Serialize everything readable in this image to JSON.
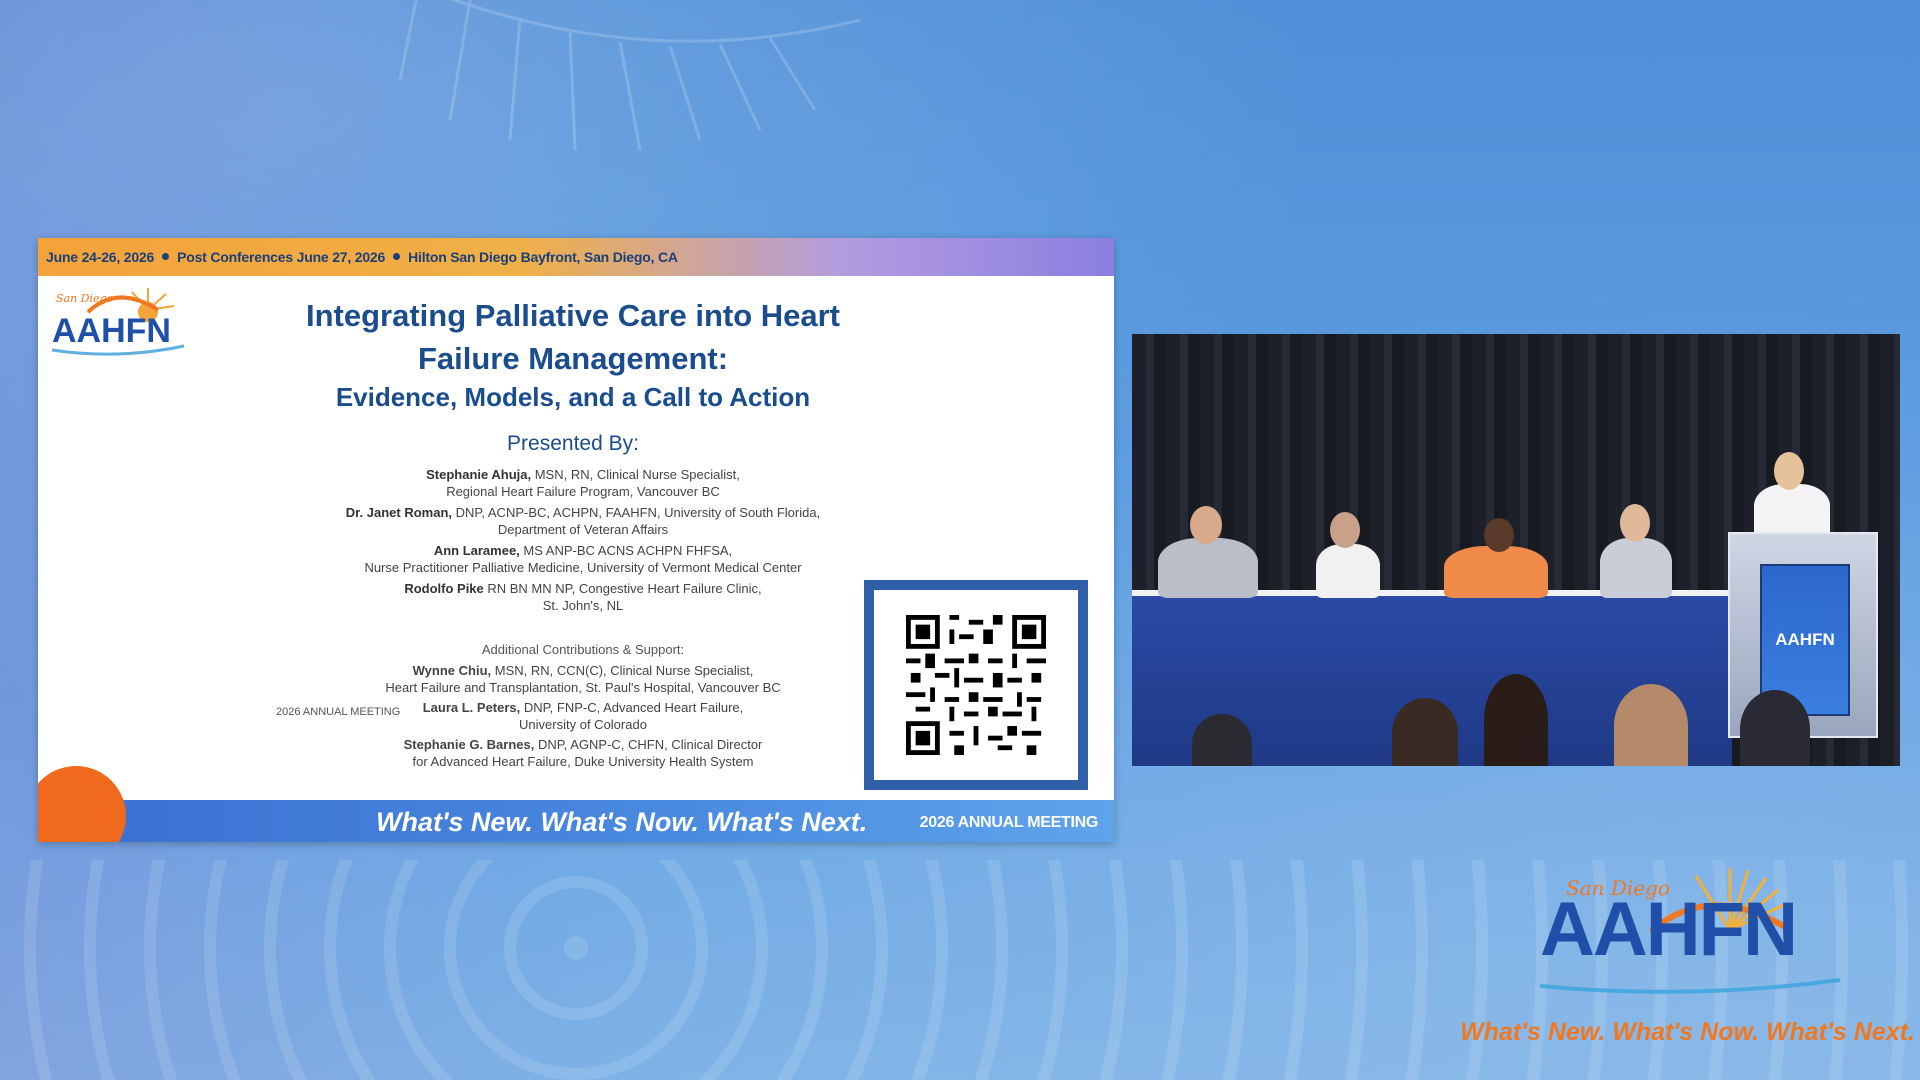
{
  "slide": {
    "event_date": "June 24-26, 2026",
    "post_conferences": "Post Conferences June 27, 2026",
    "venue": "Hilton San Diego Bayfront, San Diego, CA",
    "logo_script": "San Diego",
    "logo_text": "AAHFN",
    "title_line1": "Integrating Palliative Care into Heart",
    "title_line2": "Failure Management:",
    "subtitle": "Evidence, Models, and a Call to Action",
    "presented_by": "Presented By:",
    "presenters": [
      {
        "name": "Stephanie Ahuja,",
        "line1": " MSN, RN, Clinical Nurse Specialist,",
        "line2": "Regional Heart Failure Program, Vancouver BC"
      },
      {
        "name": "Dr. Janet Roman,",
        "line1": " DNP, ACNP-BC, ACHPN, FAAHFN, University of South Florida,",
        "line2": "Department of Veteran Affairs"
      },
      {
        "name": "Ann Laramee,",
        "line1": " MS ANP-BC ACNS ACHPN FHFSA,",
        "line2": "Nurse Practitioner Palliative Medicine, University of Vermont Medical Center"
      },
      {
        "name": "Rodolfo Pike",
        "line1": " RN BN MN NP, Congestive Heart Failure Clinic,",
        "line2": "St. John's, NL"
      }
    ],
    "contributions_heading": "Additional Contributions & Support:",
    "contributors": [
      {
        "name": "Wynne Chiu,",
        "line1": " MSN, RN, CCN(C), Clinical Nurse Specialist,",
        "line2": "Heart Failure and Transplantation, St. Paul's Hospital, Vancouver BC"
      },
      {
        "name": "Laura L. Peters,",
        "line1": " DNP, FNP-C, Advanced Heart Failure,",
        "line2": "University of Colorado"
      },
      {
        "name": "Stephanie G. Barnes,",
        "line1": " DNP, AGNP-C, CHFN, Clinical Director",
        "line2": "for Advanced Heart Failure, Duke University Health System"
      }
    ],
    "small_mark": "2026 ANNUAL MEETING",
    "tagline": "What's New. What's Now. What's Next.",
    "annual_meeting": "2026 ANNUAL MEETING"
  },
  "video": {
    "podium_logo": "AAHFN"
  },
  "brand": {
    "script": "San Diego",
    "logo_text": "AAHFN",
    "tagline": "What's New. What's Now. What's Next."
  },
  "colors": {
    "navy": "#1b4c8c",
    "orange": "#f07820",
    "blue_bar": "#3a6fd1"
  }
}
